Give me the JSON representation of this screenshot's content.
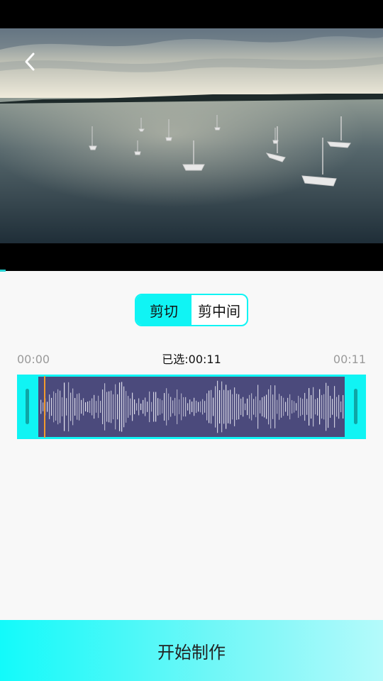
{
  "video": {
    "colors": {
      "sky_top": "#7f8f9c",
      "horizon": "#efe9d8",
      "water": "#3a4c57"
    }
  },
  "header": {
    "back_icon": "chevron-left-icon"
  },
  "mode_toggle": {
    "options": [
      "剪切",
      "剪中间"
    ],
    "selected": "剪切"
  },
  "timeline": {
    "start_time": "00:00",
    "selected_label": "已选:00:11",
    "end_time": "00:11"
  },
  "waveform": {
    "accent_color": "#10f4f4",
    "box_color": "#4b4a7c",
    "playhead_color": "#f29a2e"
  },
  "action": {
    "start_label": "开始制作"
  }
}
